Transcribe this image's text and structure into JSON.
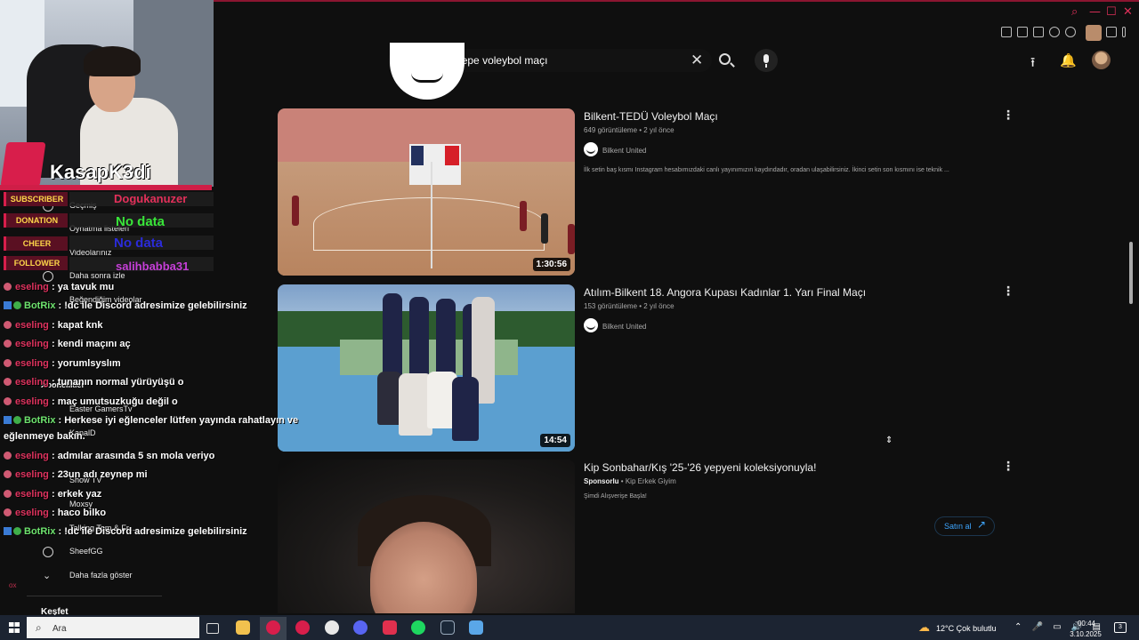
{
  "browser": {
    "controls": {
      "minimize": "—",
      "maximize": "☐",
      "close": "✕",
      "search": "⌕"
    },
    "profile_icon": "profile-picture"
  },
  "youtube": {
    "search": {
      "query": "bilkent hacettepe voleybol maçı",
      "clear_icon": "✕"
    },
    "header_icons": {
      "upload": "⭱",
      "bell": "🔔"
    },
    "results": [
      {
        "title": "Bilkent-TEDÜ Voleybol Maçı",
        "meta": "649 görüntüleme • 2 yıl önce",
        "channel": "Bilkent United",
        "description": "İlk setin baş kısmı Instagram hesabımızdaki canlı yayınımızın kaydındadır, oradan ulaşabilirsiniz. İkinci setin son kısmını ise teknik ...",
        "duration": "1:30:56"
      },
      {
        "title": "Atılım-Bilkent 18. Angora Kupası Kadınlar 1. Yarı Final Maçı",
        "meta": "153 görüntüleme • 2 yıl önce",
        "channel": "Bilkent United",
        "description": "",
        "duration": "14:54"
      }
    ],
    "ad": {
      "title": "Kip Sonbahar/Kış '25-'26 yepyeni koleksiyonuyla!",
      "sponsored": "Sponsorlu",
      "advertiser": "Kip Erkek Giyim",
      "description": "Şimdi Alışverişe Başla!",
      "cta": "Satın al",
      "cta_icon": "↗"
    },
    "more_icon": "⋮",
    "sidebar": {
      "items": [
        "Geçmiş",
        "Oynatma listeleri",
        "Videolarınız",
        "Daha sonra izle",
        "Beğendiğim videolar",
        "Abonelikler",
        "Easter GamersTv",
        "KanalD",
        "Show TV",
        "Moxsy",
        "Talking Tom & Fr...",
        "SheefGG"
      ],
      "show_more": "Daha fazla göster",
      "explore": "Keşfet"
    }
  },
  "overlay": {
    "streamer": "KasapK3di",
    "alerts": [
      {
        "label": "SUBSCRIBER",
        "value": "Dogukanuzer",
        "color": "#e3305a"
      },
      {
        "label": "DONATION",
        "value": "No data",
        "color": "#39e639"
      },
      {
        "label": "CHEER",
        "value": "No data",
        "color": "#2b2bd9"
      },
      {
        "label": "FOLLOWER",
        "value": "salihbabba31",
        "color": "#c63fd8"
      }
    ],
    "chat": [
      {
        "user": "eseling",
        "msg": ": ya tavuk mu",
        "bot": false
      },
      {
        "user": "BotRix",
        "msg": ": !dc ile Discord adresimize gelebilirsiniz",
        "bot": true
      },
      {
        "user": "eseling",
        "msg": ": kapat knk",
        "bot": false
      },
      {
        "user": "eseling",
        "msg": ": kendi maçını aç",
        "bot": false
      },
      {
        "user": "eseling",
        "msg": ": yorumlsyslım",
        "bot": false
      },
      {
        "user": "eseling",
        "msg": ": tunanın normal yürüyüşü o",
        "bot": false
      },
      {
        "user": "eseling",
        "msg": ": maç umutsuzkuğu değil o",
        "bot": false
      },
      {
        "user": "BotRix",
        "msg": ": Herkese iyi eğlenceler lütfen yayında rahatlayın ve",
        "bot": true
      },
      {
        "user": "",
        "msg": "eğlenmeye bakın.",
        "bot": false
      },
      {
        "user": "eseling",
        "msg": ": admılar arasında 5 sn mola veriyo",
        "bot": false
      },
      {
        "user": "eseling",
        "msg": ": 23un adı zeynep mi",
        "bot": false
      },
      {
        "user": "eseling",
        "msg": ": erkek yaz",
        "bot": false
      },
      {
        "user": "eseling",
        "msg": ": haco bilko",
        "bot": false
      },
      {
        "user": "BotRix",
        "msg": ": !dc ile Discord adresimize gelebilirsiniz",
        "bot": true
      }
    ],
    "corner_text": "ox"
  },
  "taskbar": {
    "search_placeholder": "Ara",
    "search_icon": "⌕",
    "weather_icon": "☁",
    "weather": "12°C  Çok bulutlu",
    "tray": "⌃ 🎤 ▭ 🔊 ▤",
    "time": "00:44",
    "date": "3.10.2025",
    "notification_count": "3"
  }
}
